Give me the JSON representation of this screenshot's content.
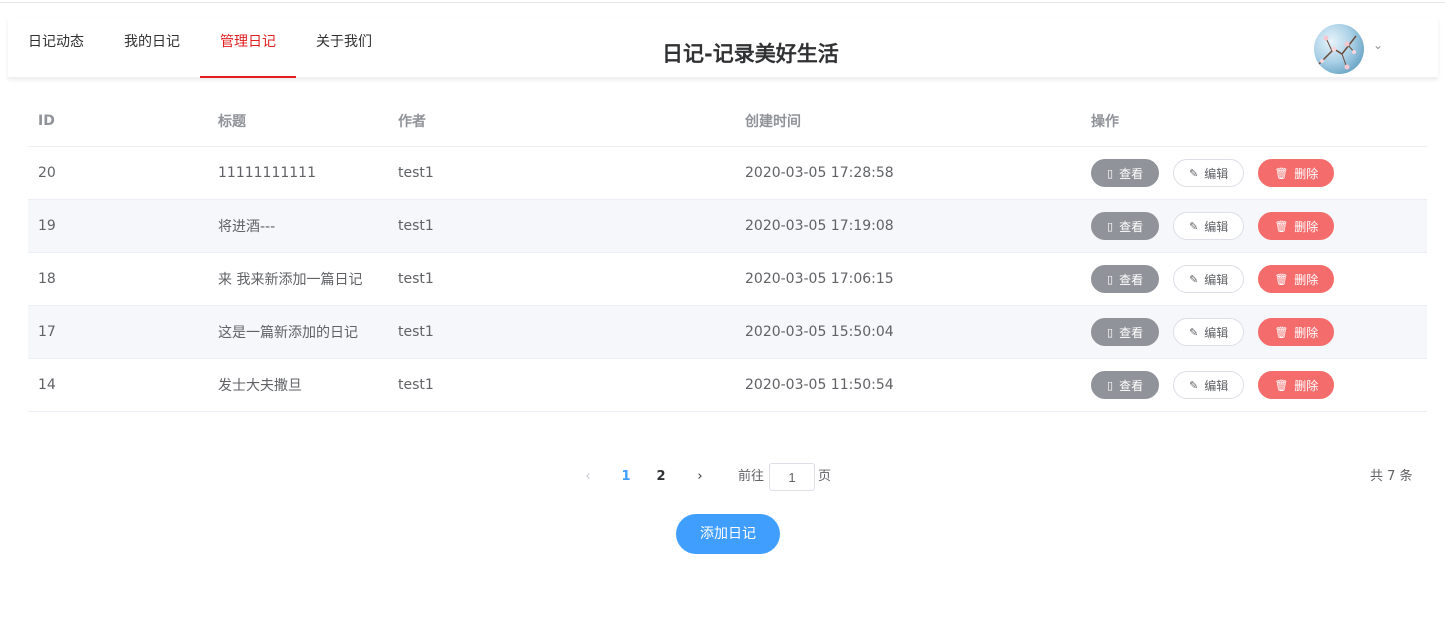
{
  "nav": {
    "items": [
      {
        "label": "日记动态"
      },
      {
        "label": "我的日记"
      },
      {
        "label": "管理日记"
      },
      {
        "label": "关于我们"
      }
    ],
    "active_index": 2
  },
  "site_title": "日记-记录美好生活",
  "user": {
    "caret": "⌄"
  },
  "table": {
    "headers": {
      "id": "ID",
      "title": "标题",
      "author": "作者",
      "time": "创建时间",
      "ops": "操作"
    },
    "rows": [
      {
        "id": "20",
        "title": "11111111111",
        "author": "test1",
        "time": "2020-03-05 17:28:58"
      },
      {
        "id": "19",
        "title": "将进酒---",
        "author": "test1",
        "time": "2020-03-05 17:19:08"
      },
      {
        "id": "18",
        "title": "来 我来新添加一篇日记",
        "author": "test1",
        "time": "2020-03-05 17:06:15"
      },
      {
        "id": "17",
        "title": "这是一篇新添加的日记",
        "author": "test1",
        "time": "2020-03-05 15:50:04"
      },
      {
        "id": "14",
        "title": "发士大夫撒旦",
        "author": "test1",
        "time": "2020-03-05 11:50:54"
      }
    ],
    "actions": {
      "view": "查看",
      "edit": "编辑",
      "delete": "删除"
    }
  },
  "pagination": {
    "prev": "‹",
    "pages": [
      "1",
      "2"
    ],
    "current": "1",
    "next": "›",
    "goto_label": "前往",
    "goto_value": "1",
    "page_suffix": "页",
    "total": "共 7 条"
  },
  "add_button": "添加日记",
  "colors": {
    "accent": "#409eff",
    "active_nav": "#e02020",
    "danger": "#f56c6c",
    "info": "#909399"
  }
}
